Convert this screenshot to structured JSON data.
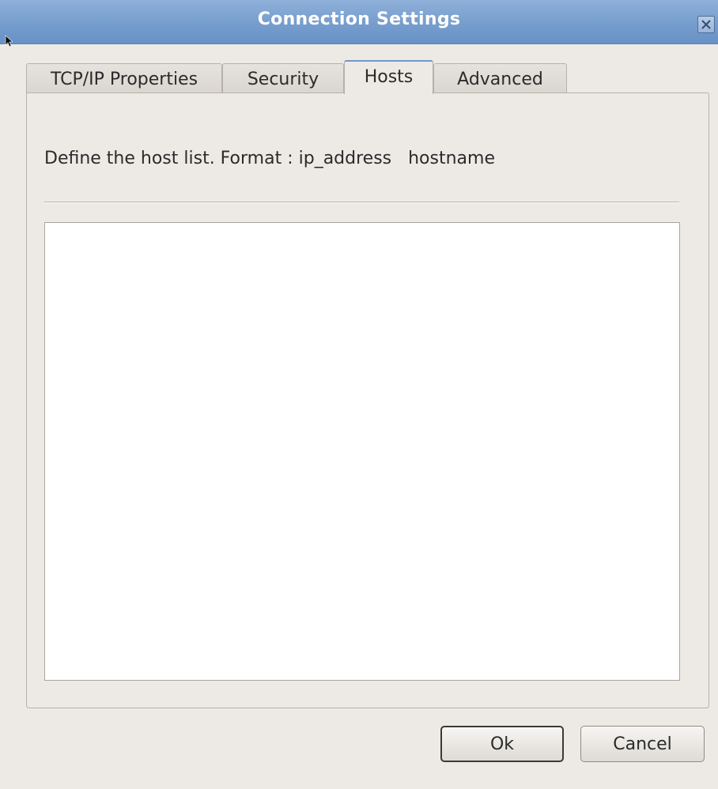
{
  "window": {
    "title": "Connection Settings",
    "close_icon": "close-icon"
  },
  "tabs": [
    {
      "label": "TCP/IP Properties",
      "active": false
    },
    {
      "label": "Security",
      "active": false
    },
    {
      "label": "Hosts",
      "active": true
    },
    {
      "label": "Advanced",
      "active": false
    }
  ],
  "hosts_panel": {
    "description": "Define the host list. Format : ip_address   hostname",
    "host_list_value": ""
  },
  "buttons": {
    "ok_label": "Ok",
    "cancel_label": "Cancel"
  },
  "colors": {
    "titlebar": "#7aa0cf",
    "window_bg": "#edeae6",
    "text": "#2b2b2b"
  }
}
